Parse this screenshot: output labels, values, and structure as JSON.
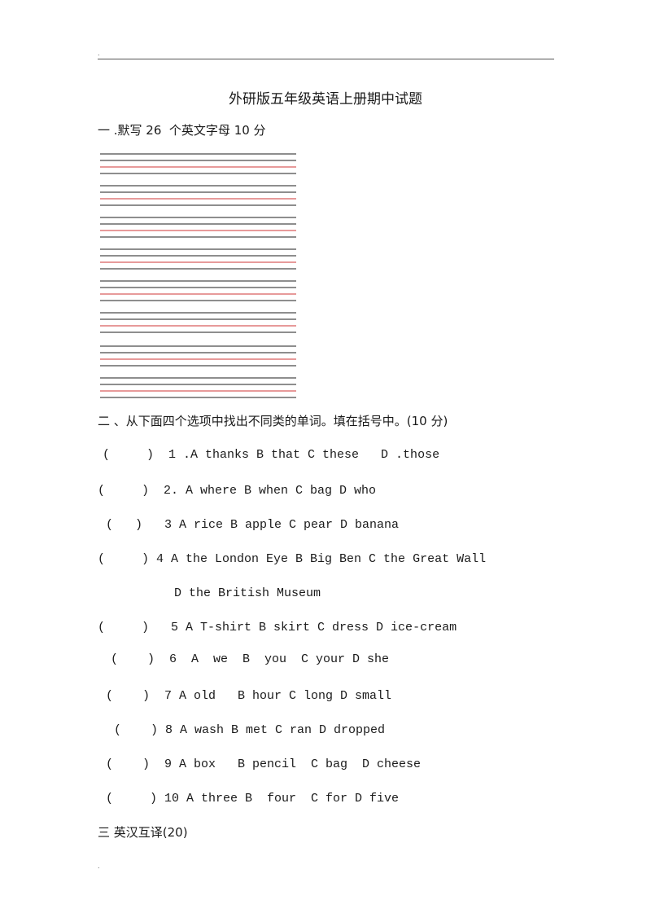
{
  "header": {
    "mark": "."
  },
  "title": "外研版五年级英语上册期中试题",
  "section1": {
    "heading": "一 .默写 26  个英文字母 10 分",
    "writing_groups": 8,
    "line_colors": {
      "guide": "#8e8e8e",
      "baseline_red": "#e79a9a"
    }
  },
  "section2": {
    "heading": "二 、从下面四个选项中找出不同类的单词。填在括号中。(10 分)",
    "questions": [
      {
        "text": "(     )  1 .A thanks B that C these   D .those"
      },
      {
        "text": "(     )  2. A where B when C bag D who"
      },
      {
        "text": "(   )   3 A rice B apple C pear D banana"
      },
      {
        "text": "(     ) 4 A the London Eye B Big Ben C the Great Wall"
      },
      {
        "text": "D the British Museum"
      },
      {
        "text": "(     )   5 A T-shirt B skirt C dress D ice-cream"
      },
      {
        "text": "(    )  6  A  we  B  you  C your D she"
      },
      {
        "text": "(    )  7 A old   B hour C long D small"
      },
      {
        "text": "(    ) 8 A wash B met C ran D dropped"
      },
      {
        "text": "(    )  9 A box   B pencil  C bag  D cheese"
      },
      {
        "text": "(     ) 10 A three B  four  C for D five"
      }
    ]
  },
  "section3": {
    "heading": "三 英汉互译(20)"
  },
  "footer": {
    "mark": "."
  }
}
